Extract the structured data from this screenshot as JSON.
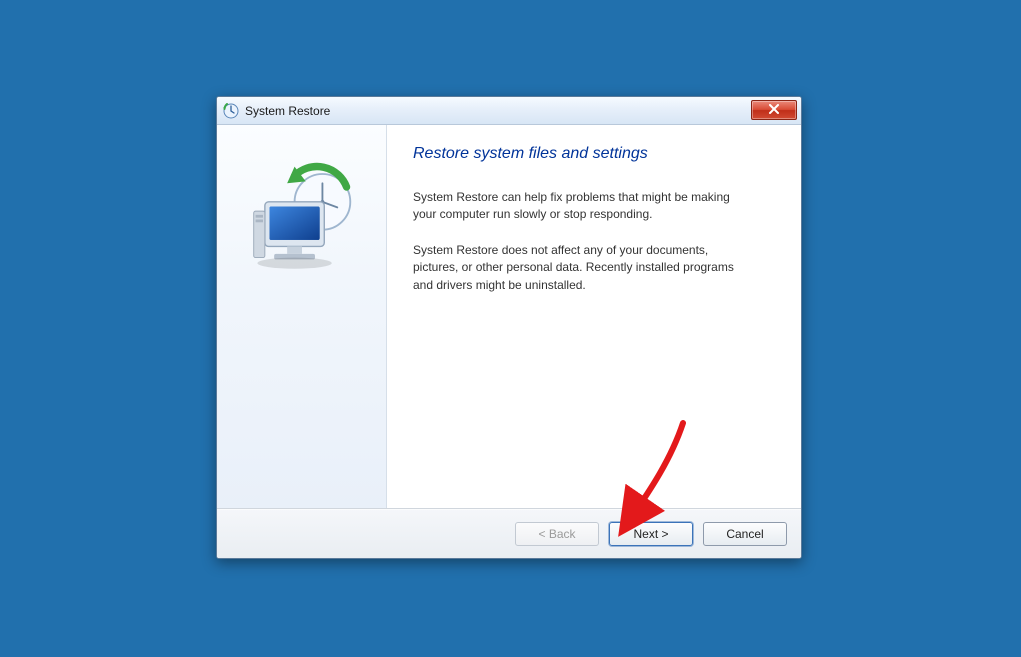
{
  "window": {
    "title": "System Restore"
  },
  "content": {
    "heading": "Restore system files and settings",
    "para1": "System Restore can help fix problems that might be making your computer run slowly or stop responding.",
    "para2": "System Restore does not affect any of your documents, pictures, or other personal data. Recently installed programs and drivers might be uninstalled."
  },
  "buttons": {
    "back": "< Back",
    "next": "Next >",
    "cancel": "Cancel"
  }
}
